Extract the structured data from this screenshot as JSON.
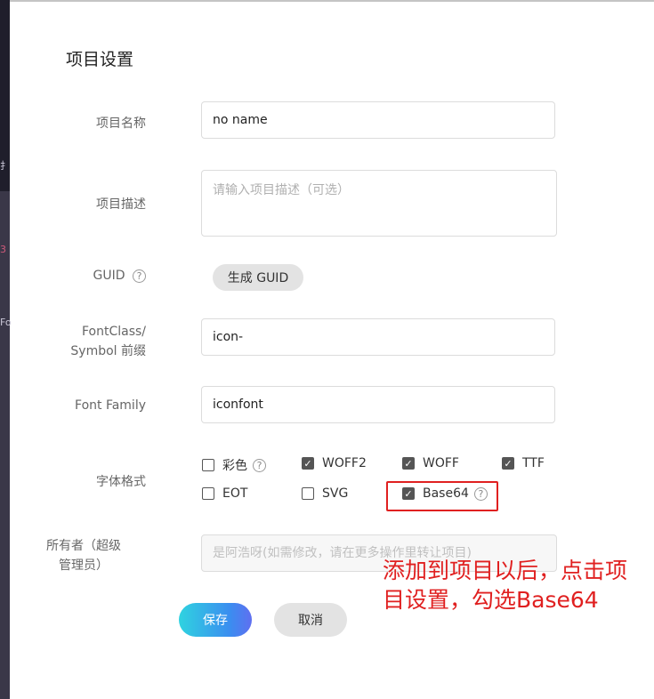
{
  "modal": {
    "title": "项目设置"
  },
  "fields": {
    "name": {
      "label": "项目名称",
      "value": "no name"
    },
    "description": {
      "label": "项目描述",
      "placeholder": "请输入项目描述（可选）"
    },
    "guid": {
      "label": "GUID",
      "help": "?",
      "button": "生成 GUID"
    },
    "prefix": {
      "label_line1": "FontClass/",
      "label_line2": "Symbol 前缀",
      "value": "icon-"
    },
    "family": {
      "label": "Font Family",
      "value": "iconfont"
    },
    "formats": {
      "label": "字体格式",
      "options": [
        {
          "label": "彩色",
          "checked": false,
          "help": "?"
        },
        {
          "label": "WOFF2",
          "checked": true
        },
        {
          "label": "WOFF",
          "checked": true
        },
        {
          "label": "TTF",
          "checked": true
        },
        {
          "label": "EOT",
          "checked": false
        },
        {
          "label": "SVG",
          "checked": false
        },
        {
          "label": "Base64",
          "checked": true,
          "help": "?"
        }
      ]
    },
    "owner": {
      "label_line1": "所有者（超级",
      "label_line2": "管理员）",
      "placeholder": "是阿浩呀(如需修改，请在更多操作里转让项目)"
    }
  },
  "actions": {
    "save": "保存",
    "cancel": "取消"
  },
  "annotation": {
    "line1": "添加到项目以后，点击项",
    "line2": "目设置，勾选Base64",
    "color": "#e02020"
  },
  "colors": {
    "accent_start": "#2fd3e0",
    "accent_end": "#5f6ff0",
    "highlight": "#e02020"
  }
}
